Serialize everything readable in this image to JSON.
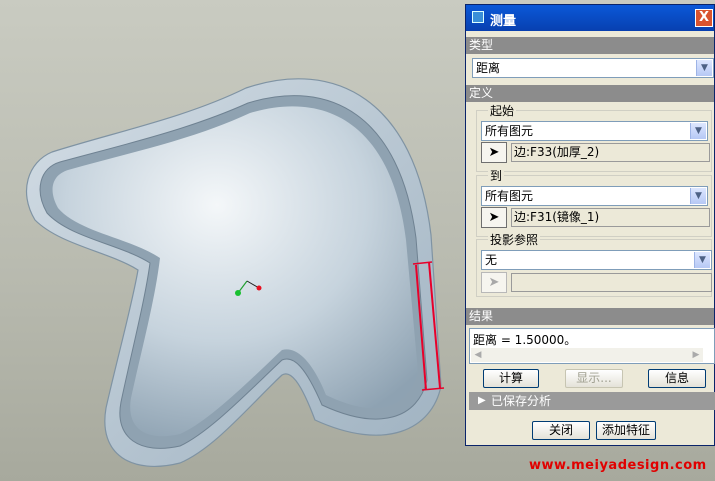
{
  "dialog": {
    "title": "测量",
    "close_label": "X",
    "sections": {
      "type": "类型",
      "definition": "定义",
      "result": "结果"
    },
    "type_select": {
      "value": "距离"
    },
    "from_group": {
      "label": "起始",
      "filter_value": "所有图元",
      "selection": "边:F33(加厚_2)"
    },
    "to_group": {
      "label": "到",
      "filter_value": "所有图元",
      "selection": "边:F31(镜像_1)"
    },
    "projection_group": {
      "label": "投影参照",
      "value": "无",
      "selection": ""
    },
    "result_text": "距离 = 1.50000。",
    "buttons": {
      "compute": "计算",
      "show": "显示...",
      "info": "信息",
      "close": "关闭",
      "add_feature": "添加特征"
    },
    "saved_analysis": "已保存分析"
  },
  "watermark": "www.meiyadesign.com",
  "colors": {
    "title_bar": "#0a50c8",
    "section_header": "#8c8c8c",
    "dialog_bg": "#ece9d8",
    "part_fill": "#b9c9d6",
    "measure_line": "#e8002a",
    "watermark": "#e10000"
  },
  "icons": [
    "dialog-icon",
    "close-icon",
    "dropdown-arrow-icon",
    "pointer-icon",
    "triangle-right-icon"
  ]
}
